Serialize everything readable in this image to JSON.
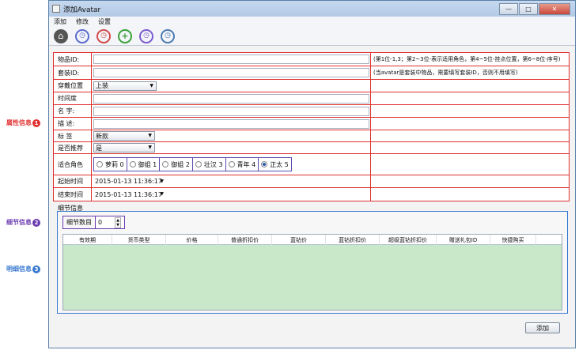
{
  "annotations": [
    {
      "text": "属性信息",
      "badge": "1",
      "color": "#e03030"
    },
    {
      "text": "细节信息",
      "badge": "2",
      "color": "#6a3ab0"
    },
    {
      "text": "明细信息",
      "badge": "3",
      "color": "#3a7ad0"
    }
  ],
  "window": {
    "title": "添加Avatar",
    "controls": {
      "minimize": "—",
      "maximize": "□",
      "close": "✕"
    }
  },
  "menu": [
    "添加",
    "修改",
    "设置"
  ],
  "toolbar": {
    "icons": [
      "home-icon",
      "alarm-clock-blue-icon",
      "alarm-clock-red-icon",
      "add-circle-icon",
      "alarm-clock-purple-icon",
      "clock-icon"
    ],
    "glyphs": {
      "home": "⌂",
      "clock": "◷",
      "add": "+"
    }
  },
  "form": {
    "item_id": {
      "label": "物品ID:",
      "value": "",
      "note": "(第1位-1,3；第2~3位-表示适用角色，第4~5位-挂点位置，第6~8位-序号)"
    },
    "set_id": {
      "label": "套装ID:",
      "value": "",
      "note": "(当avatar是套装中物品，需要填写套装ID，否则不用填写)"
    },
    "wear_pos": {
      "label": "穿戴位置",
      "value": "上装"
    },
    "duration": {
      "label": "时间度",
      "value": ""
    },
    "name": {
      "label": "名  字:",
      "value": ""
    },
    "desc": {
      "label": "描  述:",
      "value": ""
    },
    "tag": {
      "label": "标  签",
      "value": "新款"
    },
    "recommend": {
      "label": "是否推荐",
      "value": "是"
    },
    "role": {
      "label": "适合角色",
      "options": [
        {
          "label": "萝莉 0",
          "selected": false
        },
        {
          "label": "御姐 1",
          "selected": false
        },
        {
          "label": "御姐 2",
          "selected": false
        },
        {
          "label": "壮汉 3",
          "selected": false
        },
        {
          "label": "青年 4",
          "selected": false
        },
        {
          "label": "正太 5",
          "selected": true
        }
      ]
    },
    "start_time": {
      "label": "起始时间",
      "value": "2015-01-13 11:36:17"
    },
    "end_time": {
      "label": "结束时间",
      "value": "2015-01-13 11:36:17"
    }
  },
  "detail": {
    "section_title": "细节信息",
    "count_label": "细节数目",
    "count_value": "0",
    "columns": [
      "有效期",
      "货币类型",
      "价格",
      "普通折扣价",
      "蓝钻价",
      "蓝钻折扣价",
      "超级蓝钻折扣价",
      "赠送礼包ID",
      "快捷购买"
    ]
  },
  "buttons": {
    "add": "添加"
  }
}
